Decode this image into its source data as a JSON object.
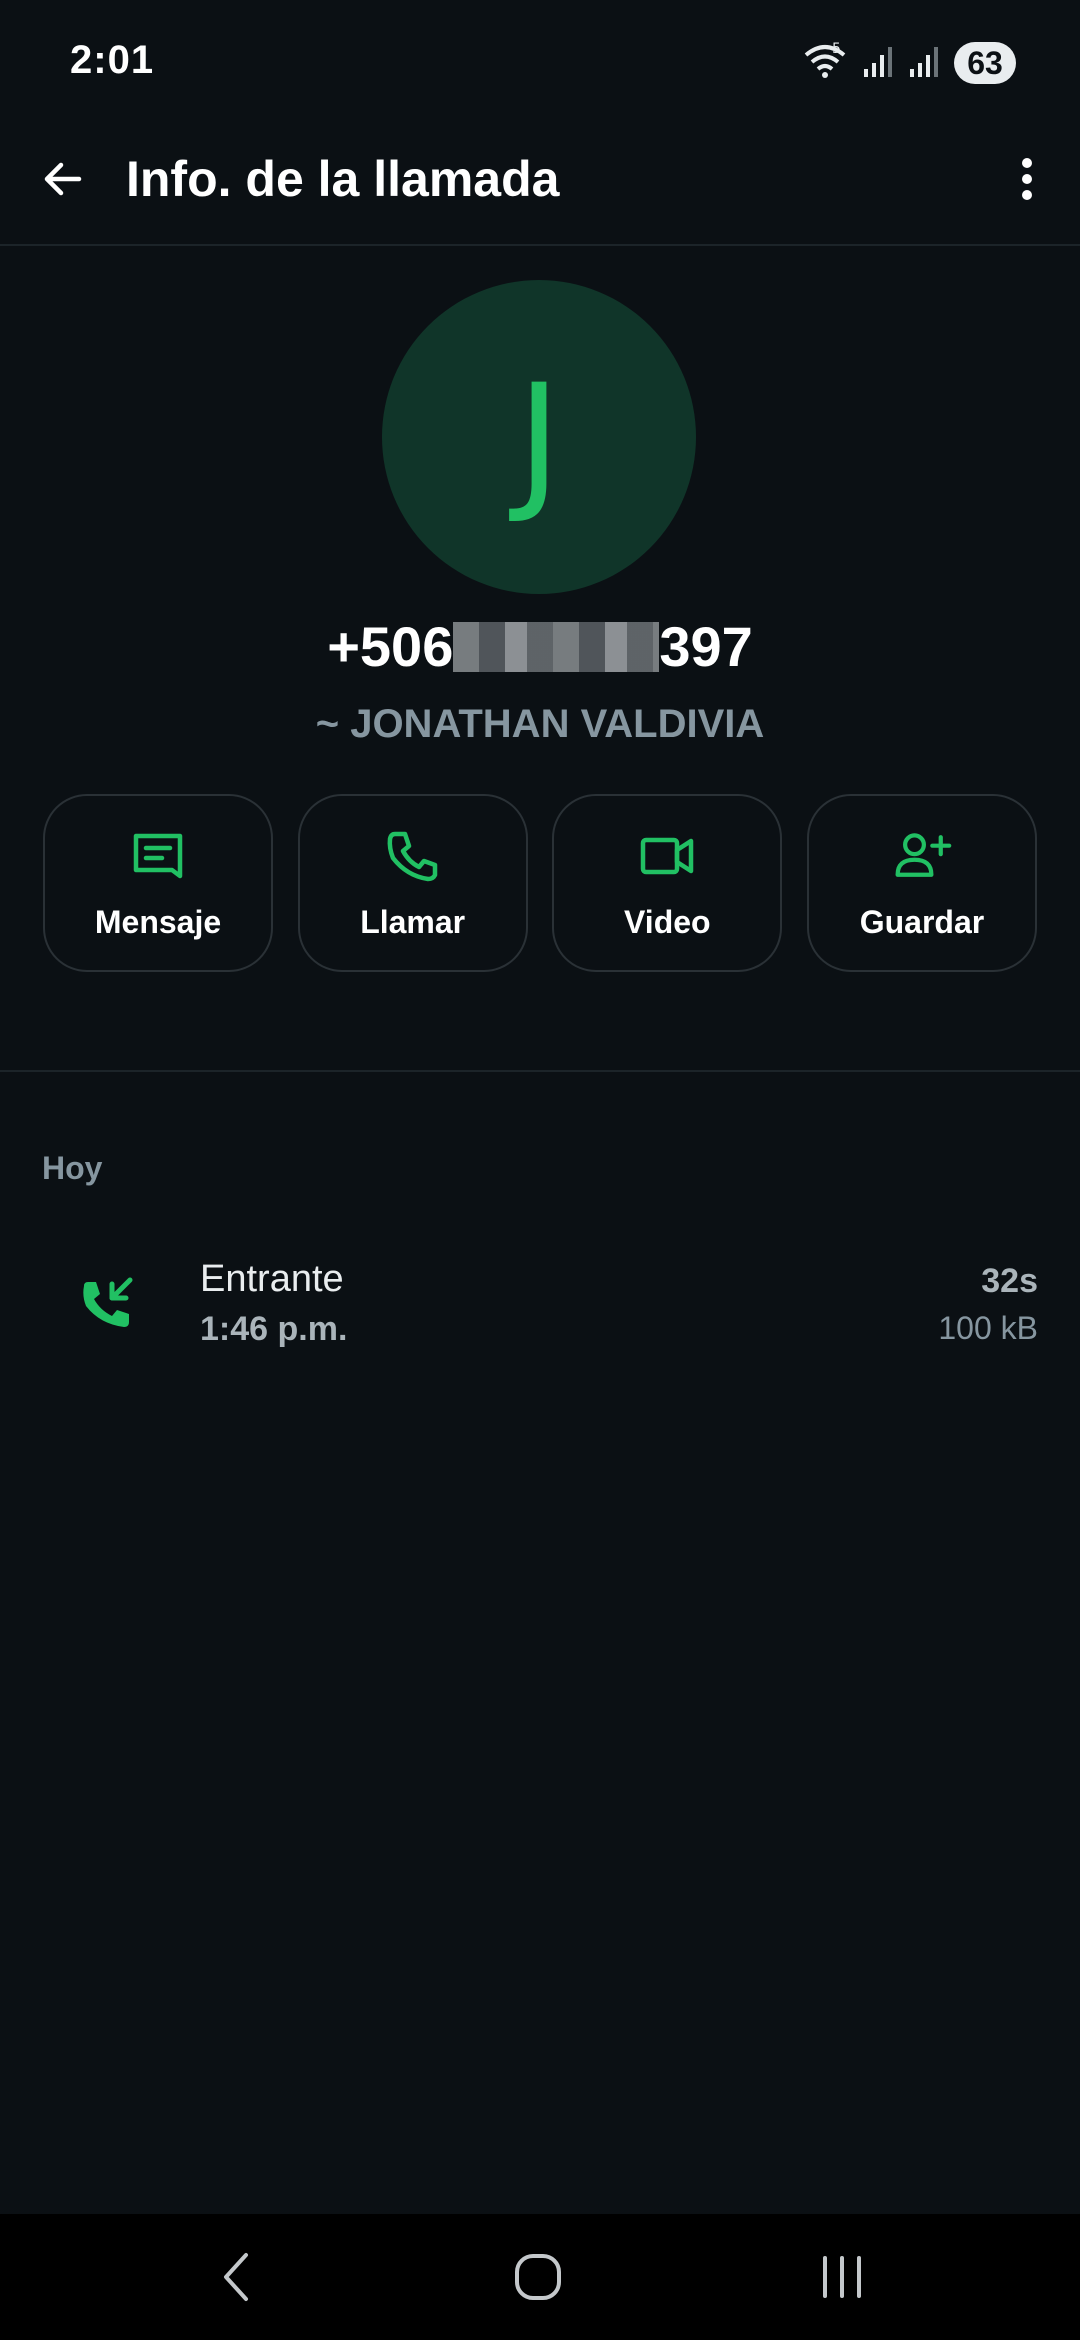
{
  "status_bar": {
    "time": "2:01",
    "battery": "63",
    "wifi_label": "5"
  },
  "app_bar": {
    "title": "Info. de la llamada",
    "back_icon": "arrow-left-icon",
    "menu_icon": "more-vertical-icon"
  },
  "contact": {
    "avatar_letter": "J",
    "phone_prefix": "+506",
    "phone_suffix": "397",
    "name": "~ JONATHAN VALDIVIA"
  },
  "actions": [
    {
      "label": "Mensaje",
      "icon": "message-icon"
    },
    {
      "label": "Llamar",
      "icon": "phone-icon"
    },
    {
      "label": "Video",
      "icon": "video-icon"
    },
    {
      "label": "Guardar",
      "icon": "add-contact-icon"
    }
  ],
  "history": {
    "section_label": "Hoy",
    "calls": [
      {
        "type": "Entrante",
        "time": "1:46 p.m.",
        "duration": "32s",
        "size": "100 kB",
        "icon": "incoming-call-icon"
      }
    ]
  },
  "colors": {
    "background": "#0b1014",
    "accent": "#21c063",
    "avatar_bg": "#103529",
    "secondary_text": "#8696a0"
  }
}
